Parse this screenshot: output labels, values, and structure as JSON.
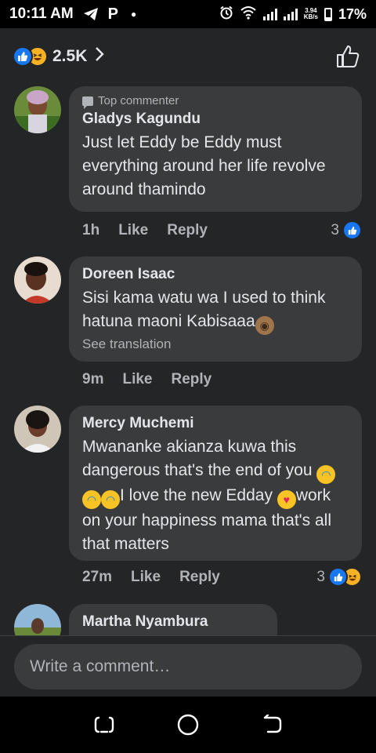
{
  "status_bar": {
    "time": "10:11 AM",
    "net_speed_value": "3.94",
    "net_speed_unit": "KB/s",
    "battery": "17%",
    "icons": [
      "telegram-icon",
      "parking-icon",
      "dot-icon",
      "alarm-icon",
      "wifi-icon",
      "signal-icon",
      "signal-icon",
      "battery-icon"
    ]
  },
  "reactions": {
    "count": "2.5K",
    "types": [
      "like",
      "haha"
    ],
    "accent": "#1877f2"
  },
  "comments": [
    {
      "badge": "Top commenter",
      "author": "Gladys Kagundu",
      "text": "Just let Eddy be Eddy must everything around her life revolve around thamindo",
      "time": "1h",
      "like": "Like",
      "reply": "Reply",
      "reaction_count": "3"
    },
    {
      "author": "Doreen Isaac",
      "text": "Sisi kama watu wa I used to think hatuna maoni Kabisaaa",
      "see_translation": "See translation",
      "time": "9m",
      "like": "Like",
      "reply": "Reply"
    },
    {
      "author": "Mercy Muchemi",
      "text_1": "Mwananke akianza kuwa this dangerous that's the end of you",
      "text_2": "I love the new Edday",
      "text_3": "work on your happiness mama that's all that matters",
      "time": "27m",
      "like": "Like",
      "reply": "Reply",
      "reaction_count": "3"
    },
    {
      "author": "Martha Nyambura"
    }
  ],
  "composer": {
    "placeholder": "Write a comment…"
  },
  "nav": {
    "buttons": [
      "recent-apps-icon",
      "home-icon",
      "back-icon"
    ]
  }
}
